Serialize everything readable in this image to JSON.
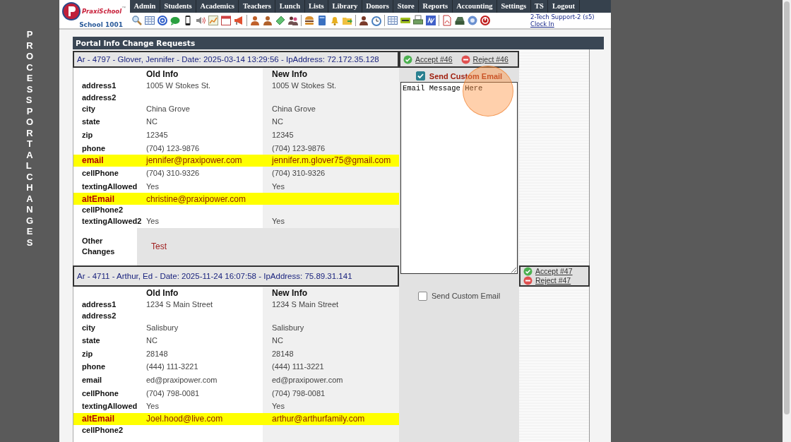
{
  "side_banner": "PROCESS PORTAL CHANGES",
  "logo": {
    "brand": "PraxiSchool",
    "tm": "™",
    "school": "School 1001"
  },
  "nav": [
    "Admin",
    "Students",
    "Academics",
    "Teachers",
    "Lunch",
    "Lists",
    "Library",
    "Donors",
    "Store",
    "Reports",
    "Accounting",
    "Settings",
    "TS",
    "Logout"
  ],
  "user": {
    "name": "2-Tech Support-2 (s5)",
    "clock_link": "Clock In"
  },
  "panel_title": "Portal Info Change Requests",
  "requests": [
    {
      "header": "Ar - 4797 - Glover, Jennifer - Date: 2025-03-14 13:29:56 - IpAddress: 72.172.35.128",
      "accept": "Accept #46",
      "reject": "Reject #46",
      "old_heading": "Old Info",
      "new_heading": "New Info",
      "rows": [
        {
          "field": "address1",
          "old": "1005 W Stokes St.",
          "new": "1005 W Stokes St.",
          "changed": false
        },
        {
          "field": "address2",
          "changed": false
        },
        {
          "field": "city",
          "old": "China Grove",
          "new": "China Grove",
          "changed": false
        },
        {
          "field": "state",
          "old": "NC",
          "new": "NC",
          "changed": false
        },
        {
          "field": "zip",
          "old": "12345",
          "new": "12345",
          "changed": false
        },
        {
          "field": "phone",
          "old": "(704) 123-9876",
          "new": "(704) 123-9876",
          "changed": false
        },
        {
          "field": "email",
          "old": "jennifer@praxipower.com",
          "new": "jennifer.m.glover75@gmail.com",
          "changed": true
        },
        {
          "field": "cellPhone",
          "old": "(704) 310-9326",
          "new": "(704) 310-9326",
          "changed": false
        },
        {
          "field": "textingAllowed",
          "old": "Yes",
          "new": "Yes",
          "changed": false
        },
        {
          "field": "altEmail",
          "old": "christine@praxipower.com",
          "changed": true
        },
        {
          "field": "cellPhone2",
          "changed": false
        },
        {
          "field": "textingAllowed2",
          "old": "Yes",
          "new": "Yes",
          "changed": false
        }
      ],
      "other_changes": {
        "label": "Other Changes",
        "value": "Test"
      },
      "custom_email": {
        "label": "Send Custom Email",
        "checked": true,
        "message": "Email Message Here"
      }
    },
    {
      "header": "Ar - 4711 - Arthur, Ed - Date: 2025-11-24 16:07:58 - IpAddress: 75.89.31.141",
      "accept": "Accept #47",
      "reject": "Reject #47",
      "old_heading": "Old Info",
      "new_heading": "New Info",
      "rows": [
        {
          "field": "address1",
          "old": "1234 S Main Street",
          "new": "1234 S Main Street",
          "changed": false
        },
        {
          "field": "address2",
          "changed": false
        },
        {
          "field": "city",
          "old": "Salisbury",
          "new": "Salisbury",
          "changed": false
        },
        {
          "field": "state",
          "old": "NC",
          "new": "NC",
          "changed": false
        },
        {
          "field": "zip",
          "old": "28148",
          "new": "28148",
          "changed": false
        },
        {
          "field": "phone",
          "old": "(444) 111-3221",
          "new": "(444) 111-3221",
          "changed": false
        },
        {
          "field": "email",
          "old": "ed@praxipower.com",
          "new": "ed@praxipower.com",
          "changed": false
        },
        {
          "field": "cellPhone",
          "old": "(704) 798-0081",
          "new": "(704) 798-0081",
          "changed": false
        },
        {
          "field": "textingAllowed",
          "old": "Yes",
          "new": "Yes",
          "changed": false
        },
        {
          "field": "altEmail",
          "old": "Joel.hood@live.com",
          "new": "arthur@arthurfamily.com",
          "changed": true
        },
        {
          "field": "cellPhone2",
          "changed": false
        }
      ],
      "custom_email": {
        "label": "Send Custom Email",
        "checked": false
      }
    }
  ]
}
